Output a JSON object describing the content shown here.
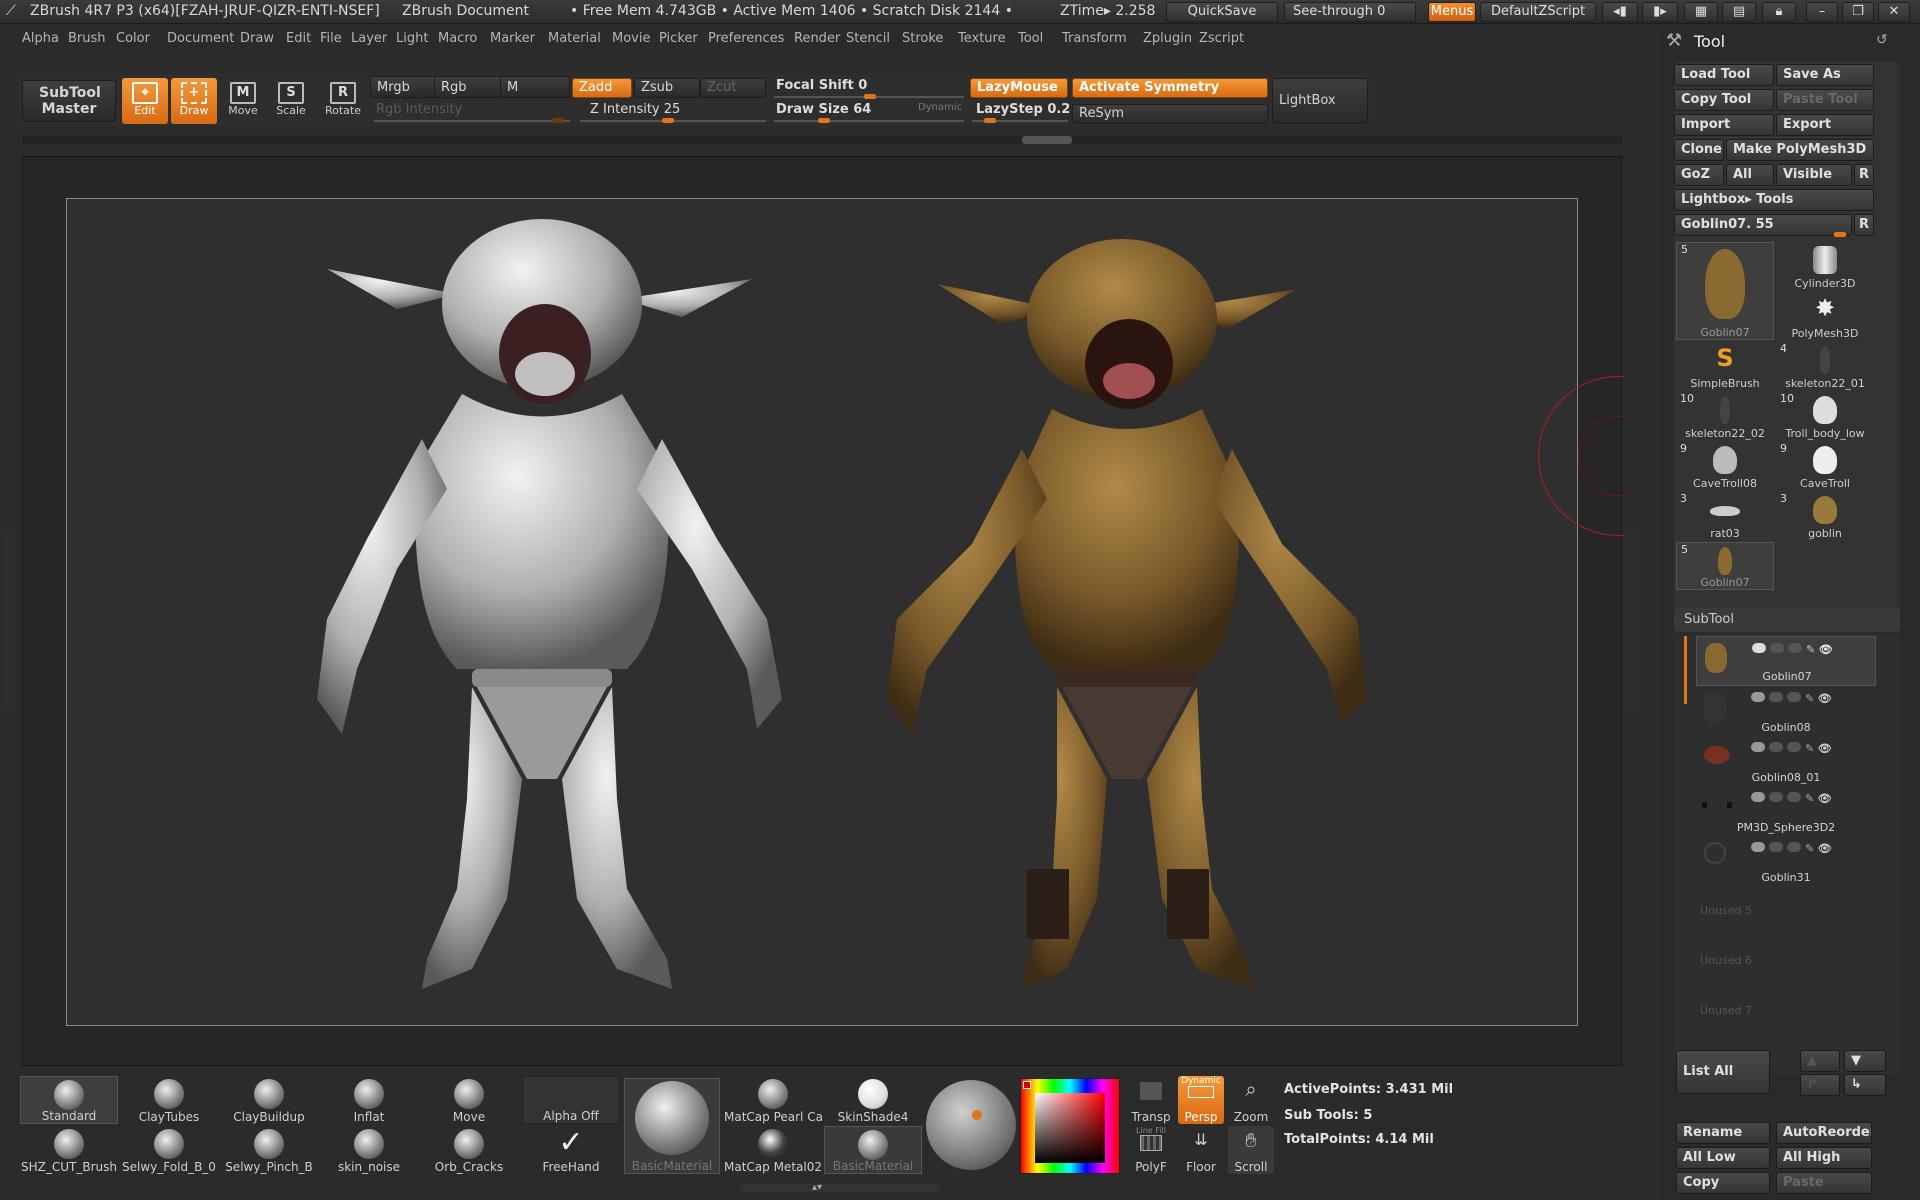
{
  "titlebar": {
    "app": "ZBrush 4R7 P3 (x64)[FZAH-JRUF-QIZR-ENTI-NSEF]",
    "document": "ZBrush Document",
    "free_mem": "• Free Mem 4.743GB • Active Mem 1406 • Scratch Disk 2144 •",
    "ztime": "ZTime▸ 2.258",
    "quicksave": "QuickSave",
    "seethrough": "See-through   0",
    "menus": "Menus",
    "defaultzscript": "DefaultZScript"
  },
  "menubar": [
    "Alpha",
    "Brush",
    "Color",
    "Document",
    "Draw",
    "Edit",
    "File",
    "Layer",
    "Light",
    "Macro",
    "Marker",
    "Material",
    "Movie",
    "Picker",
    "Preferences",
    "Render",
    "Stencil",
    "Stroke",
    "Texture",
    "Tool",
    "Transform",
    "Zplugin",
    "Zscript"
  ],
  "toolbar": {
    "subtool_master": "SubTool Master",
    "edit": "Edit",
    "draw": "Draw",
    "move": "Move",
    "scale": "Scale",
    "rotate": "Rotate",
    "mrgb": "Mrgb",
    "rgb": "Rgb",
    "m": "M",
    "zadd": "Zadd",
    "zsub": "Zsub",
    "zcut": "Zcut",
    "rgb_intensity": "Rgb Intensity",
    "z_intensity": "Z Intensity 25",
    "focal_shift": "Focal Shift 0",
    "draw_size": "Draw Size 64",
    "dynamic": "Dynamic",
    "lazymouse": "LazyMouse",
    "lazystep": "LazyStep 0.25",
    "activate_symmetry": "Activate Symmetry",
    "resym": "ReSym",
    "lightbox": "LightBox",
    "z_intensity_value": 25,
    "focal_shift_value": 0,
    "draw_size_value": 64
  },
  "tool_panel": {
    "title": "Tool",
    "buttons": {
      "load_tool": "Load Tool",
      "save_as": "Save As",
      "copy_tool": "Copy Tool",
      "paste_tool": "Paste Tool",
      "import": "Import",
      "export": "Export",
      "clone": "Clone",
      "make_polymesh": "Make PolyMesh3D",
      "goz": "GoZ",
      "all": "All",
      "visible": "Visible",
      "r": "R",
      "lightbox_tools": "Lightbox▸ Tools",
      "current_tool": "Goblin07. 55",
      "r2": "R"
    },
    "tools": [
      {
        "num": "5",
        "name": "Goblin07"
      },
      {
        "num": "",
        "name": "Cylinder3D"
      },
      {
        "num": "",
        "name": "PolyMesh3D"
      },
      {
        "num": "",
        "name": "SimpleBrush"
      },
      {
        "num": "4",
        "name": "skeleton22_01"
      },
      {
        "num": "10",
        "name": "skeleton22_02"
      },
      {
        "num": "10",
        "name": "Troll_body_low"
      },
      {
        "num": "9",
        "name": "CaveTroll08"
      },
      {
        "num": "9",
        "name": "CaveTroll"
      },
      {
        "num": "3",
        "name": "rat03"
      },
      {
        "num": "3",
        "name": "goblin"
      },
      {
        "num": "5",
        "name": "Goblin07"
      }
    ],
    "subtool_header": "SubTool",
    "subtools": [
      "Goblin07",
      "Goblin08",
      "Goblin08_01",
      "PM3D_Sphere3D2",
      "Goblin31"
    ],
    "unused": [
      "Unused 5",
      "Unused 6",
      "Unused 7"
    ],
    "list_all": "List All",
    "rename": "Rename",
    "autoreorder": "AutoReorder",
    "all_low": "All Low",
    "all_high": "All High",
    "copy": "Copy",
    "paste": "Paste"
  },
  "bottom": {
    "brushes": [
      "Standard",
      "ClayTubes",
      "ClayBuildup",
      "Inflat",
      "Move",
      "SHZ_CUT_Brush",
      "Selwy_Fold_B_0",
      "Selwy_Pinch_B",
      "skin_noise",
      "Orb_Cracks"
    ],
    "alpha_off": "Alpha  Off",
    "freehand": "FreeHand",
    "materials": [
      "BasicMaterial",
      "MatCap Pearl Ca",
      "SkinShade4",
      "MatCap Metal02",
      "BasicMaterial"
    ],
    "transp": "Transp",
    "persp": "Persp",
    "dynamic": "Dynamic",
    "zoom": "Zoom",
    "polyf": "PolyF",
    "floor": "Floor",
    "scroll": "Scroll",
    "line_fill": "Line Fill",
    "active_points": "ActivePoints: 3.431  Mil",
    "sub_tools": "Sub Tools: 5",
    "total_points": "TotalPoints: 4.14  Mil"
  },
  "colors": {
    "accent": "#e07418",
    "bg": "#2b2b2b",
    "panel": "#333333"
  }
}
